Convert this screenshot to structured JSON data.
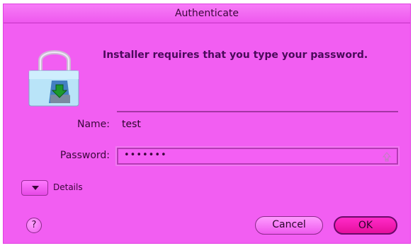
{
  "window": {
    "title": "Authenticate"
  },
  "dialog": {
    "message": "Installer requires that you type your password.",
    "icon": "lock-installer-icon",
    "name_label": "Name:",
    "name_value": "test",
    "password_label": "Password:",
    "password_value": "•••••••",
    "caps_icon": "caps-lock-indicator-icon",
    "details_label": "Details",
    "details_expanded": false,
    "help_label": "?",
    "cancel_label": "Cancel",
    "ok_label": "OK"
  },
  "colors": {
    "background": "#f25ef2",
    "titlebar": "#f77cf7",
    "ok_button": "#ff2bc8",
    "text": "#3a063a",
    "message_text": "#4a0a5a"
  }
}
